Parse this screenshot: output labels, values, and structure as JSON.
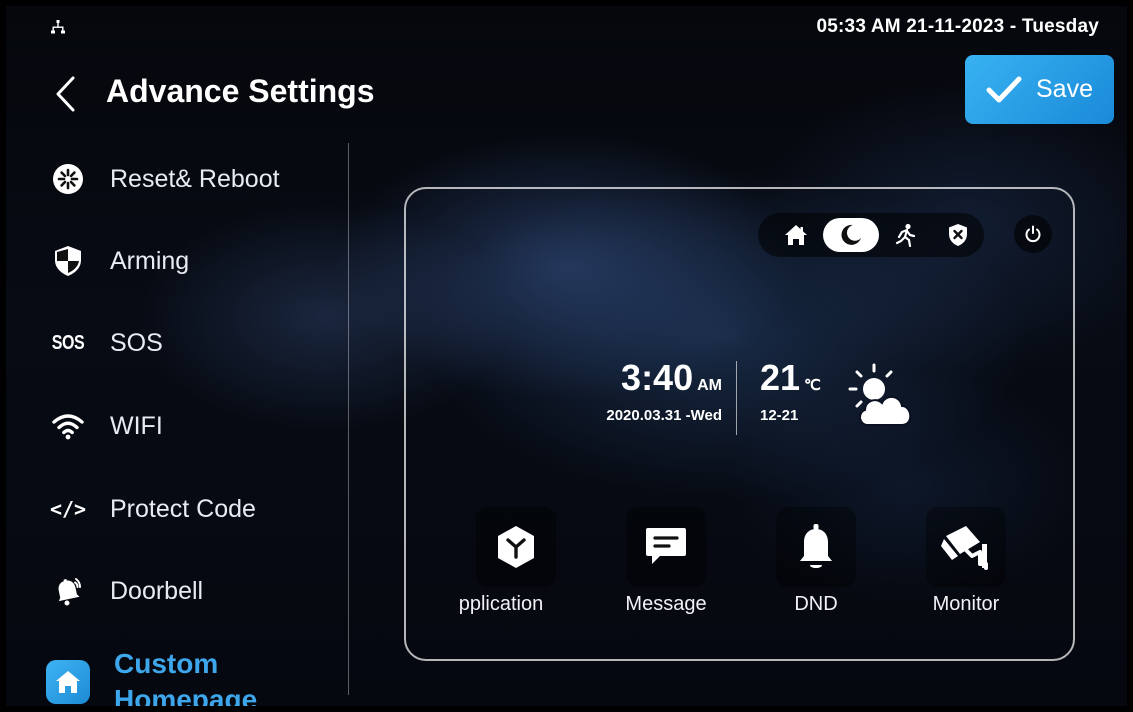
{
  "status_bar": {
    "network_icon": "network-icon",
    "datetime": "05:33 AM  21-11-2023 - Tuesday"
  },
  "header": {
    "back_icon": "chevron-left-icon",
    "title": "Advance Settings",
    "save_label": "Save",
    "save_icon": "check-icon",
    "accent_color": "#2c9ee6"
  },
  "sidebar": {
    "items": [
      {
        "label": "Reset& Reboot",
        "icon": "reset-icon"
      },
      {
        "label": "Arming",
        "icon": "shield-icon"
      },
      {
        "label": "SOS",
        "icon": "sos-icon",
        "icon_text": "SOS"
      },
      {
        "label": "WIFI",
        "icon": "wifi-icon"
      },
      {
        "label": "Protect Code",
        "icon": "code-icon",
        "icon_text": "</>"
      },
      {
        "label": "Doorbell",
        "icon": "doorbell-icon"
      },
      {
        "label": "Custom Homepage",
        "icon": "home-icon",
        "active": true
      }
    ]
  },
  "preview": {
    "modes": [
      "home-mode-icon",
      "night-mode-icon",
      "away-mode-icon",
      "disarm-mode-icon"
    ],
    "active_mode": "night-mode-icon",
    "power_icon": "power-icon",
    "clock": {
      "time": "3:40",
      "ampm": "AM",
      "date": "2020.03.31 -Wed"
    },
    "weather": {
      "temp": "21",
      "unit": "℃",
      "range": "12-21",
      "icon": "partly-cloudy-icon"
    },
    "apps": [
      {
        "label": "pplication",
        "icon": "application-icon"
      },
      {
        "label": "Message",
        "icon": "message-icon"
      },
      {
        "label": "DND",
        "icon": "bell-icon"
      },
      {
        "label": "Monitor",
        "icon": "camera-icon"
      }
    ]
  }
}
